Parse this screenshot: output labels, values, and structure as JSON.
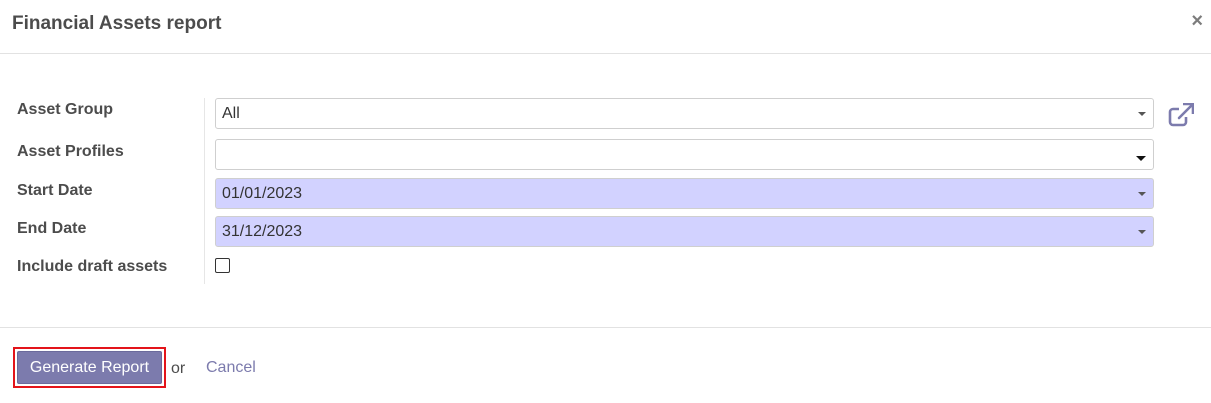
{
  "dialog": {
    "title": "Financial Assets report",
    "close_glyph": "×"
  },
  "form": {
    "asset_group": {
      "label": "Asset Group",
      "value": "All",
      "external_link_icon": "external-link-icon"
    },
    "asset_profiles": {
      "label": "Asset Profiles",
      "value": ""
    },
    "start_date": {
      "label": "Start Date",
      "value": "01/01/2023"
    },
    "end_date": {
      "label": "End Date",
      "value": "31/12/2023"
    },
    "include_draft": {
      "label": "Include draft assets",
      "checked": false
    }
  },
  "footer": {
    "generate_label": "Generate Report",
    "or_text": "or",
    "cancel_label": "Cancel"
  },
  "colors": {
    "primary": "#7c7bad",
    "required_field_bg": "#d2d2ff",
    "highlight_border": "#e3141a"
  }
}
